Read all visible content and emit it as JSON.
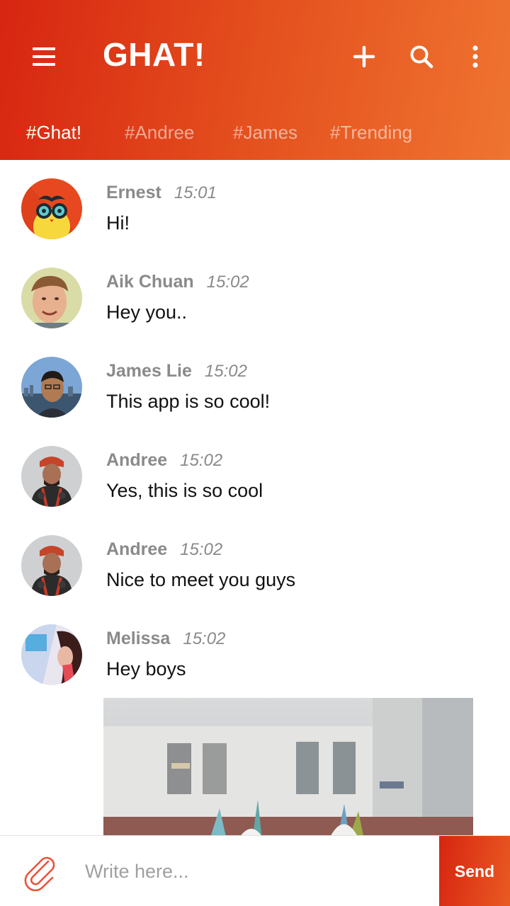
{
  "app": {
    "title": "GHAT!"
  },
  "colors": {
    "accent_start": "#d72511",
    "accent_end": "#ef7430"
  },
  "toolbar": {
    "menu_icon": "hamburger-menu-icon",
    "add_icon": "plus-icon",
    "search_icon": "search-icon",
    "more_icon": "more-vertical-icon"
  },
  "tabs": [
    {
      "label": "#Ghat!",
      "active": true
    },
    {
      "label": "#Andree",
      "active": false
    },
    {
      "label": "#James",
      "active": false
    },
    {
      "label": "#Trending",
      "active": false
    }
  ],
  "messages": [
    {
      "name": "Ernest",
      "time": "15:01",
      "text": "Hi!"
    },
    {
      "name": "Aik Chuan",
      "time": "15:02",
      "text": "Hey you.."
    },
    {
      "name": "James Lie",
      "time": "15:02",
      "text": "This app is so cool!"
    },
    {
      "name": "Andree",
      "time": "15:02",
      "text": "Yes, this is so cool"
    },
    {
      "name": "Andree",
      "time": "15:02",
      "text": "Nice to meet you guys"
    },
    {
      "name": "Melissa",
      "time": "15:02",
      "text": "Hey boys"
    }
  ],
  "composer": {
    "attach_icon": "paperclip-icon",
    "placeholder": "Write here...",
    "send_label": "Send"
  }
}
